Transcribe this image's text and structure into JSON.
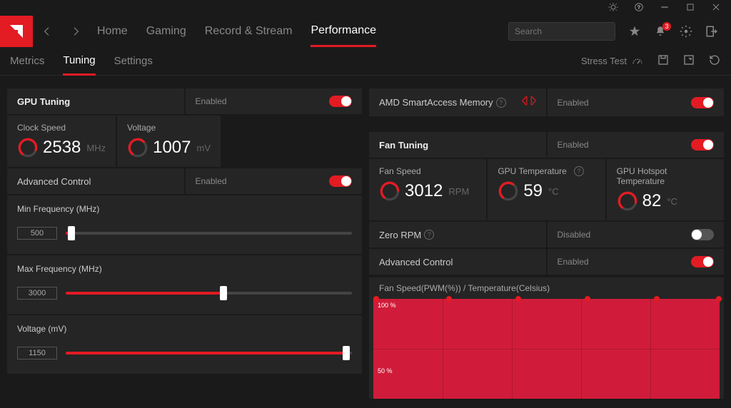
{
  "titlebar": {},
  "nav": {
    "tabs": [
      "Home",
      "Gaming",
      "Record & Stream",
      "Performance"
    ],
    "active": 3,
    "search_placeholder": "Search",
    "notification_badge": "3"
  },
  "subnav": {
    "tabs": [
      "Metrics",
      "Tuning",
      "Settings"
    ],
    "active": 1,
    "stress_test": "Stress Test"
  },
  "gpu": {
    "title": "GPU Tuning",
    "enabled_label": "Enabled",
    "clock_label": "Clock Speed",
    "clock_value": "2538",
    "clock_unit": "MHz",
    "voltage_label": "Voltage",
    "voltage_value": "1007",
    "voltage_unit": "mV",
    "advanced_label": "Advanced Control",
    "sliders": {
      "min_freq": {
        "label": "Min Frequency (MHz)",
        "value": "500",
        "pct": 2
      },
      "max_freq": {
        "label": "Max Frequency (MHz)",
        "value": "3000",
        "pct": 55
      },
      "voltage": {
        "label": "Voltage (mV)",
        "value": "1150",
        "pct": 98
      }
    }
  },
  "sam": {
    "title": "AMD SmartAccess Memory",
    "enabled_label": "Enabled"
  },
  "fan": {
    "title": "Fan Tuning",
    "enabled_label": "Enabled",
    "speed_label": "Fan Speed",
    "speed_value": "3012",
    "speed_unit": "RPM",
    "gpu_temp_label": "GPU Temperature",
    "gpu_temp_value": "59",
    "gpu_temp_unit": "°C",
    "hotspot_label": "GPU Hotspot Temperature",
    "hotspot_value": "82",
    "hotspot_unit": "°C",
    "zero_rpm_label": "Zero RPM",
    "disabled_label": "Disabled",
    "advanced_label": "Advanced Control",
    "graph_title": "Fan Speed(PWM(%)) / Temperature(Celsius)",
    "y100": "100 %",
    "y50": "50 %",
    "points": [
      0,
      21,
      41,
      61,
      81,
      99
    ]
  }
}
